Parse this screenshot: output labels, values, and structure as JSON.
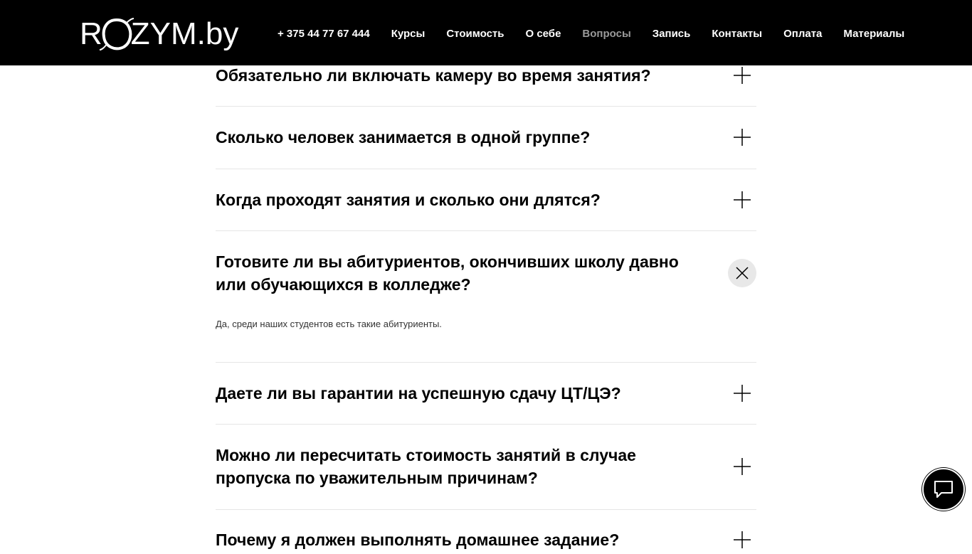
{
  "header": {
    "logo_left": "R",
    "logo_right": "ZYM.by",
    "nav": [
      {
        "label": "+ 375 44 77 67 444"
      },
      {
        "label": "Курсы"
      },
      {
        "label": "Стоимость"
      },
      {
        "label": "О себе"
      },
      {
        "label": "Вопросы",
        "active": true
      },
      {
        "label": "Запись"
      },
      {
        "label": "Контакты"
      },
      {
        "label": "Оплата"
      },
      {
        "label": "Материалы"
      }
    ]
  },
  "faq": {
    "items": [
      {
        "question": "Обязательно ли включать камеру во время занятия?",
        "open": false
      },
      {
        "question": "Сколько человек занимается в одной группе?",
        "open": false
      },
      {
        "question": "Когда проходят занятия и сколько они длятся?",
        "open": false
      },
      {
        "question": "Готовите ли вы абитуриентов, окончивших школу давно или обучающихся в колледже?",
        "open": true,
        "answer": "Да, среди наших студентов есть такие абитуриенты."
      },
      {
        "question": "Даете ли вы гарантии на успешную сдачу ЦТ/ЦЭ?",
        "open": false
      },
      {
        "question": "Можно ли пересчитать стоимость занятий в случае пропуска по уважительным причинам?",
        "open": false
      },
      {
        "question": "Почему я должен выполнять домашнее задание?",
        "open": false
      }
    ]
  },
  "icons": {
    "plus": "plus-icon",
    "close": "close-icon",
    "chat": "chat-icon"
  },
  "colors": {
    "header_bg": "#000000",
    "nav_active": "#9a9a9a",
    "divider": "#e6e6e6",
    "close_bg": "#e8e8e8"
  }
}
